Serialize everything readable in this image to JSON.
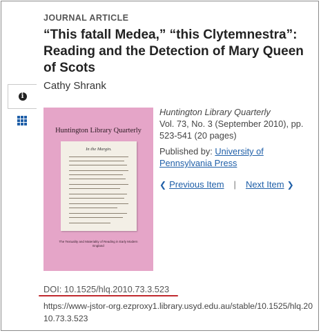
{
  "article": {
    "type_label": "JOURNAL ARTICLE",
    "title": "“This fatall Medea,” “this Clytemnestra”: Reading and the Detection of Mary Queen of Scots",
    "author": "Cathy Shrank"
  },
  "side_tabs": [
    {
      "icon": "info-icon",
      "active": true
    },
    {
      "icon": "grid-icon",
      "active": false
    }
  ],
  "cover": {
    "title": "Huntington Library Quarterly",
    "page_heading": "In the Margin.",
    "footer": "The Textuality and Materiality of Reading in Early Modern England",
    "background": "#e5a5c8"
  },
  "meta": {
    "journal": "Huntington Library Quarterly",
    "volume_info": "Vol. 73, No. 3 (September 2010), pp. 523-541 (20 pages)",
    "published_by_label": "Published by: ",
    "publisher": "University of Pennsylvania Press"
  },
  "nav": {
    "previous_label": "Previous Item",
    "next_label": "Next Item",
    "separator": "|"
  },
  "doi": "DOI: 10.1525/hlq.2010.73.3.523",
  "stable_url": "https://www-jstor-org.ezproxy1.library.usyd.edu.au/stable/10.1525/hlq.2010.73.3.523",
  "colors": {
    "link": "#1f5fa8",
    "underline_annotation": "#c0282d"
  }
}
